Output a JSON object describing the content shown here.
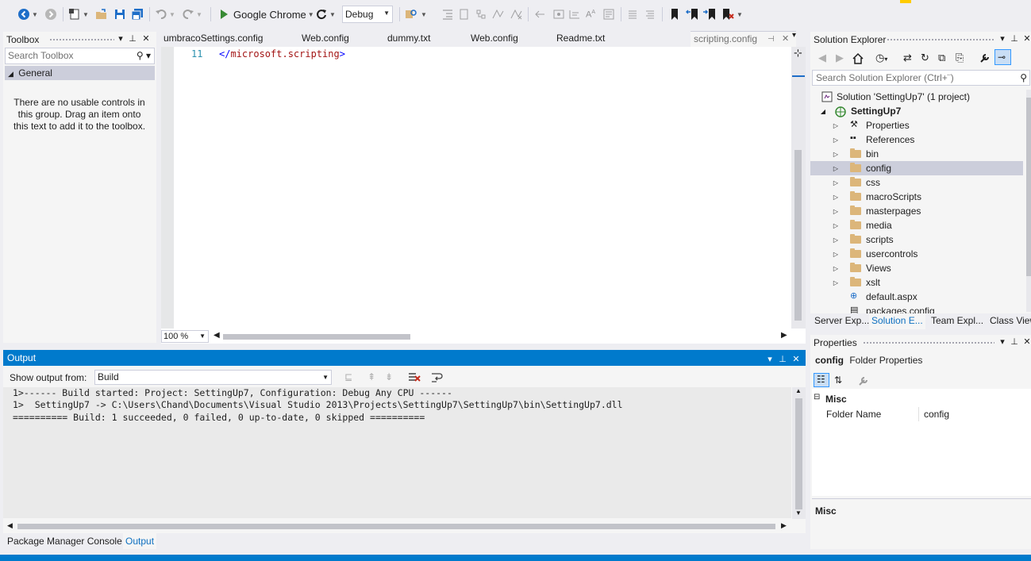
{
  "toolbar": {
    "run_target": "Google Chrome",
    "configuration": "Debug"
  },
  "toolbox": {
    "title": "Toolbox",
    "search_placeholder": "Search Toolbox",
    "group": "General",
    "empty_message": "There are no usable controls in this group. Drag an item onto this text to add it to the toolbox."
  },
  "editor": {
    "tabs": [
      "umbracoSettings.config",
      "Web.config",
      "dummy.txt",
      "Web.config",
      "Readme.txt",
      "scripting.config"
    ],
    "active_tab": "scripting.config",
    "line_number": "11",
    "code_line": "</microsoft.scripting>",
    "zoom": "100 %"
  },
  "solution_explorer": {
    "title": "Solution Explorer",
    "search_placeholder": "Search Solution Explorer (Ctrl+¨)",
    "solution": "Solution 'SettingUp7' (1 project)",
    "project": "SettingUp7",
    "items": [
      {
        "label": "Properties",
        "icon": "wrench-icon"
      },
      {
        "label": "References",
        "icon": "references-icon"
      },
      {
        "label": "bin",
        "icon": "folder-icon"
      },
      {
        "label": "config",
        "icon": "folder-icon",
        "selected": true
      },
      {
        "label": "css",
        "icon": "folder-icon"
      },
      {
        "label": "macroScripts",
        "icon": "folder-icon"
      },
      {
        "label": "masterpages",
        "icon": "folder-icon"
      },
      {
        "label": "media",
        "icon": "folder-icon"
      },
      {
        "label": "scripts",
        "icon": "folder-icon"
      },
      {
        "label": "usercontrols",
        "icon": "folder-icon"
      },
      {
        "label": "Views",
        "icon": "folder-icon"
      },
      {
        "label": "xslt",
        "icon": "folder-icon"
      },
      {
        "label": "default.aspx",
        "icon": "web-file-icon"
      },
      {
        "label": "packages.config",
        "icon": "config-file-icon"
      }
    ],
    "bottom_tabs": [
      "Server Exp...",
      "Solution E...",
      "Team Expl...",
      "Class View"
    ],
    "active_bottom_tab": "Solution E..."
  },
  "properties": {
    "title": "Properties",
    "object_name": "config",
    "object_type": "Folder Properties",
    "category": "Misc",
    "rows": [
      {
        "name": "Folder Name",
        "value": "config"
      }
    ],
    "description_title": "Misc"
  },
  "output": {
    "title": "Output",
    "show_from_label": "Show output from:",
    "source": "Build",
    "lines": [
      "1>------ Build started: Project: SettingUp7, Configuration: Debug Any CPU ------",
      "1>  SettingUp7 -> C:\\Users\\Chand\\Documents\\Visual Studio 2013\\Projects\\SettingUp7\\SettingUp7\\bin\\SettingUp7.dll",
      "========== Build: 1 succeeded, 0 failed, 0 up-to-date, 0 skipped =========="
    ],
    "bottom_tabs": [
      "Package Manager Console",
      "Output"
    ],
    "active_bottom_tab": "Output"
  },
  "colors": {
    "accent": "#007acc",
    "selection": "#cccedb",
    "background": "#eeeef2"
  }
}
